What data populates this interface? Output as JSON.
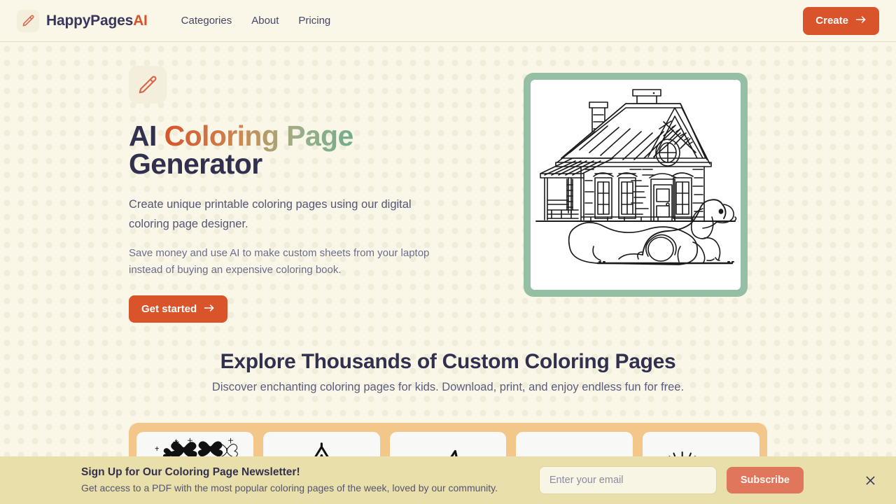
{
  "header": {
    "brand": {
      "name_main": "HappyPages",
      "name_accent": "AI",
      "icon": "pencil-icon"
    },
    "nav": [
      {
        "label": "Categories"
      },
      {
        "label": "About"
      },
      {
        "label": "Pricing"
      }
    ],
    "create_button": {
      "label": "Create",
      "icon": "arrow-right-icon"
    }
  },
  "hero": {
    "icon": "pencil-icon",
    "title_part1": "AI ",
    "title_gradient": "Coloring Page",
    "title_part2": "Generator",
    "subtitle": "Create unique printable coloring pages using our digital coloring page designer.",
    "note": "Save money and use AI to make custom sheets from your laptop instead of buying an expensive coloring book.",
    "cta": {
      "label": "Get started",
      "icon": "arrow-right-icon"
    },
    "preview": {
      "alt": "coloring-page-house-with-dog"
    }
  },
  "explore": {
    "title": "Explore Thousands of Custom Coloring Pages",
    "subtitle": "Discover enchanting coloring pages for kids. Download, print, and enjoy endless fun for free.",
    "cards": [
      {
        "name": "butterflies-and-sparkles"
      },
      {
        "name": "tent"
      },
      {
        "name": "shark-fin"
      },
      {
        "name": "bunny-ears"
      },
      {
        "name": "sunrise"
      }
    ]
  },
  "newsletter": {
    "title": "Sign Up for Our Coloring Page Newsletter!",
    "subtitle": "Get access to a PDF with the most popular coloring pages of the week, loved by our community.",
    "email_placeholder": "Enter your email",
    "email_value": "",
    "subscribe_label": "Subscribe",
    "close_icon": "close-icon"
  },
  "colors": {
    "page_bg": "#faf7e8",
    "accent_orange": "#d9542b",
    "accent_green": "#95bfa5",
    "newsletter_bg": "#e9dfab",
    "gallery_bg": "#f3c689",
    "subscribe_bg": "#e0765c",
    "heading_navy": "#32304f"
  }
}
